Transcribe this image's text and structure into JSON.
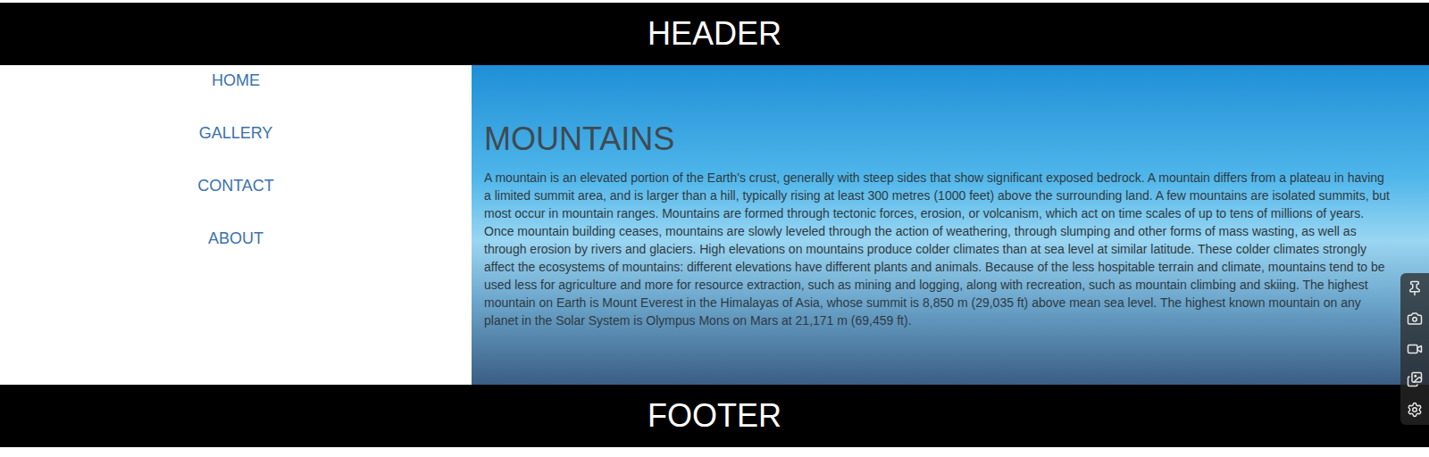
{
  "header": {
    "title": "HEADER"
  },
  "nav": {
    "items": [
      {
        "label": "HOME"
      },
      {
        "label": "GALLERY"
      },
      {
        "label": "CONTACT"
      },
      {
        "label": "ABOUT"
      }
    ]
  },
  "content": {
    "heading": "MOUNTAINS",
    "paragraph": "A mountain is an elevated portion of the Earth's crust, generally with steep sides that show significant exposed bedrock. A mountain differs from a plateau in having a limited summit area, and is larger than a hill, typically rising at least 300 metres (1000 feet) above the surrounding land. A few mountains are isolated summits, but most occur in mountain ranges. Mountains are formed through tectonic forces, erosion, or volcanism, which act on time scales of up to tens of millions of years. Once mountain building ceases, mountains are slowly leveled through the action of weathering, through slumping and other forms of mass wasting, as well as through erosion by rivers and glaciers. High elevations on mountains produce colder climates than at sea level at similar latitude. These colder climates strongly affect the ecosystems of mountains: different elevations have different plants and animals. Because of the less hospitable terrain and climate, mountains tend to be used less for agriculture and more for resource extraction, such as mining and logging, along with recreation, such as mountain climbing and skiing. The highest mountain on Earth is Mount Everest in the Himalayas of Asia, whose summit is 8,850 m (29,035 ft) above mean sea level. The highest known mountain on any planet in the Solar System is Olympus Mons on Mars at 21,171 m (69,459 ft)."
  },
  "footer": {
    "title": "FOOTER"
  }
}
